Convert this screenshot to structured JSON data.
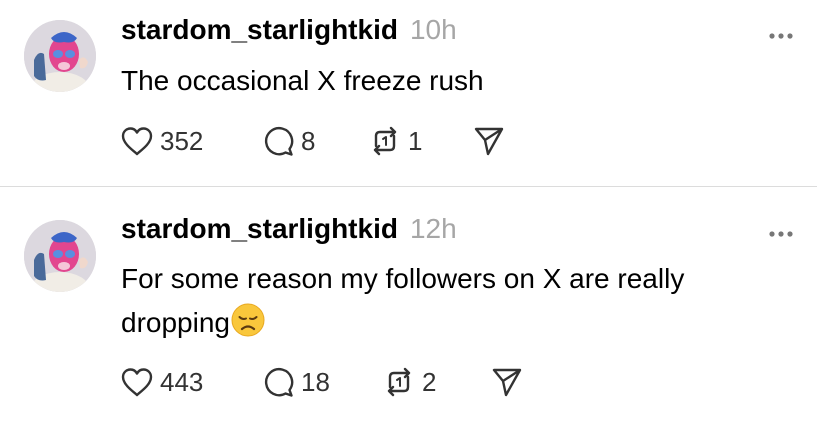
{
  "posts": [
    {
      "username": "stardom_starlightkid",
      "time": "10h",
      "text": "The occasional X freeze rush",
      "emoji": "",
      "likes": "352",
      "replies": "8",
      "reposts": "1"
    },
    {
      "username": "stardom_starlightkid",
      "time": "12h",
      "text": "For some reason my followers on X are really dropping",
      "emoji": "disappointed-face",
      "likes": "443",
      "replies": "18",
      "reposts": "2"
    }
  ],
  "icons": {
    "more": "ellipsis-icon",
    "like": "heart-icon",
    "reply": "comment-icon",
    "repost": "repost-icon",
    "share": "send-icon"
  },
  "colors": {
    "text": "#000000",
    "muted": "#a6a6a6",
    "icon": "#333333",
    "divider": "#dcdcdc"
  }
}
